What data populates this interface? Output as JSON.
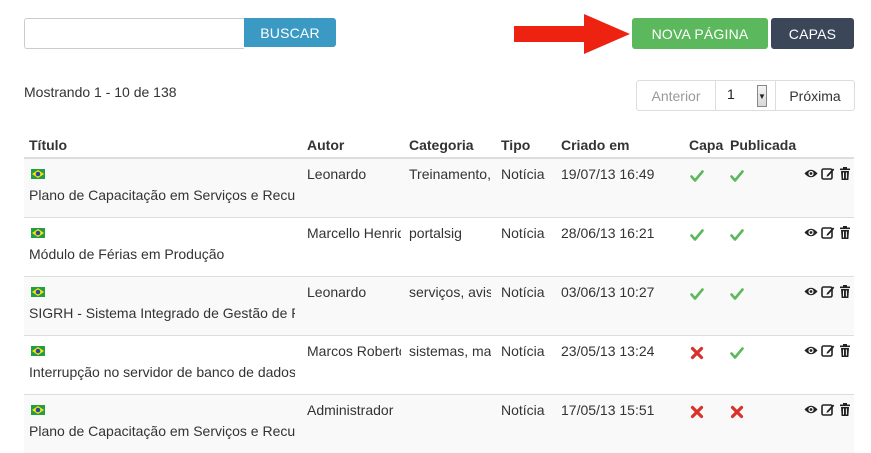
{
  "search": {
    "value": "",
    "placeholder": "",
    "button_label": "BUSCAR"
  },
  "toolbar": {
    "new_page_label": "NOVA PÁGINA",
    "capas_label": "CAPAS"
  },
  "summary": "Mostrando 1 - 10 de 138",
  "pager": {
    "prev_label": "Anterior",
    "page_value": "1",
    "next_label": "Próxima"
  },
  "columns": [
    "Título",
    "Autor",
    "Categoria",
    "Tipo",
    "Criado em",
    "Capa",
    "Publicada"
  ],
  "rows": [
    {
      "title": "Plano de Capacitação em Serviços e Recursos",
      "author": "Leonardo",
      "category": "Treinamento,",
      "type": "Notícia",
      "created": "19/07/13 16:49",
      "capa": "yes",
      "publicada": "yes"
    },
    {
      "title": "Módulo de Férias em Produção",
      "author": "Marcello Henrique",
      "category": "portalsig",
      "type": "Notícia",
      "created": "28/06/13 16:21",
      "capa": "yes",
      "publicada": "yes"
    },
    {
      "title": "SIGRH - Sistema Integrado de Gestão de Recursos",
      "author": "Leonardo",
      "category": "serviços, avisos",
      "type": "Notícia",
      "created": "03/06/13 10:27",
      "capa": "yes",
      "publicada": "yes"
    },
    {
      "title": "Interrupção no servidor de banco de dados",
      "author": "Marcos Roberto",
      "category": "sistemas, manutenção",
      "type": "Notícia",
      "created": "23/05/13 13:24",
      "capa": "no",
      "publicada": "yes"
    },
    {
      "title": "Plano de Capacitação em Serviços e Recursos",
      "author": "Administrador",
      "category": "",
      "type": "Notícia",
      "created": "17/05/13 15:51",
      "capa": "no",
      "publicada": "no"
    }
  ],
  "colors": {
    "primary": "#3a9ac4",
    "success": "#5cb85c",
    "dark": "#3b4758",
    "check": "#5cb85c",
    "cross": "#d9322a",
    "arrow": "#ee2211"
  },
  "icons": {
    "view": "eye-icon",
    "edit": "edit-icon",
    "delete": "trash-icon",
    "flag": "brazil-flag-icon"
  }
}
